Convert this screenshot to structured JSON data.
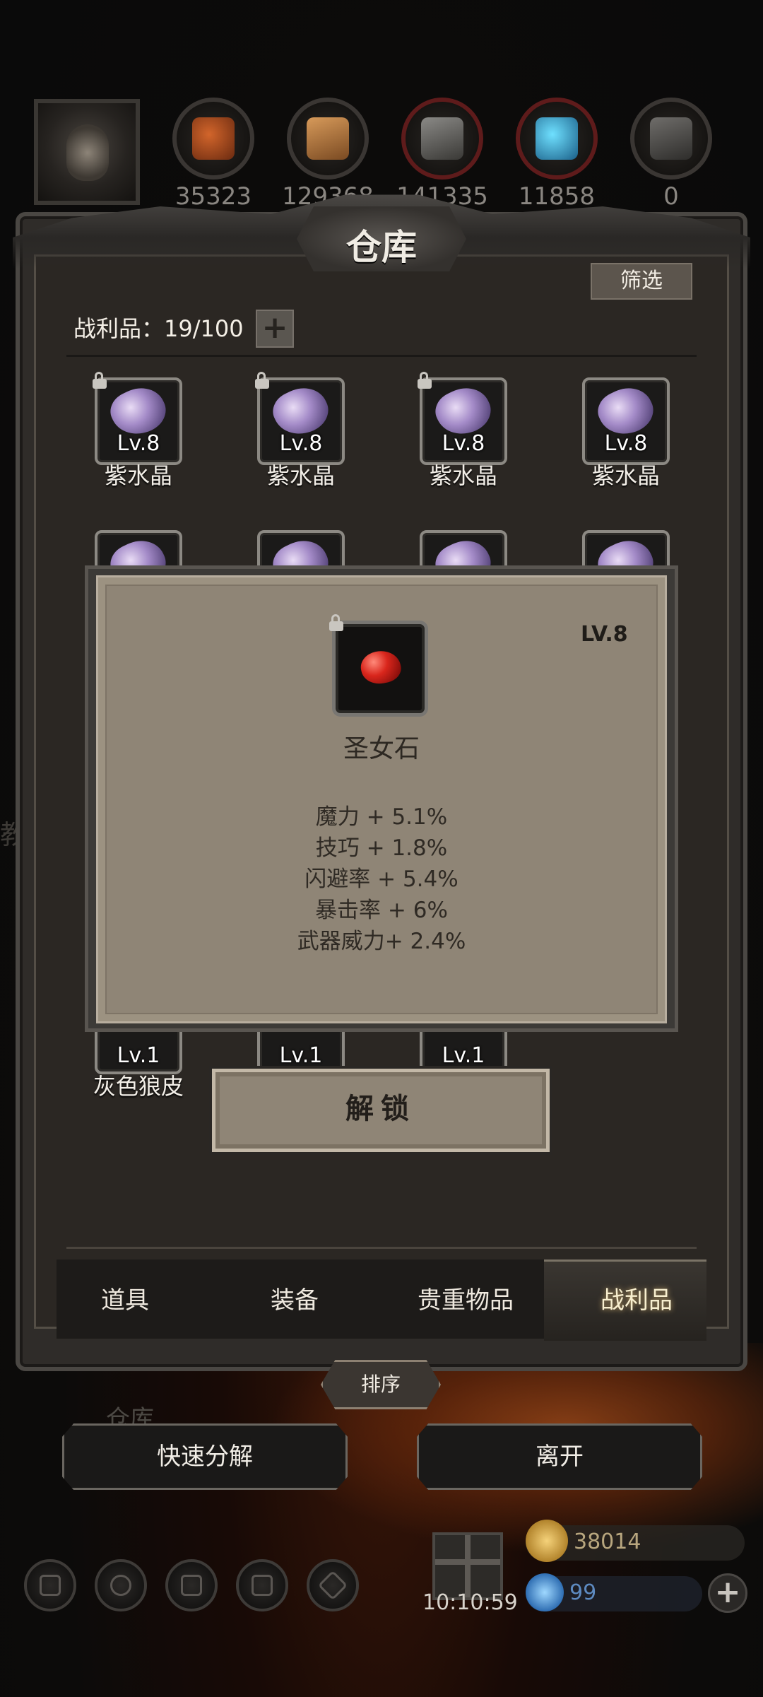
{
  "top_bar": {
    "resources": [
      {
        "name": "meat",
        "icon": "meat-icon",
        "value": "35323"
      },
      {
        "name": "wood",
        "icon": "wood-icon",
        "value": "129368"
      },
      {
        "name": "stone",
        "icon": "stone-icon",
        "value": "141335"
      },
      {
        "name": "crystal",
        "icon": "crystal-icon",
        "value": "11858"
      },
      {
        "name": "iron",
        "icon": "iron-icon",
        "value": "0"
      }
    ]
  },
  "panel": {
    "title": "仓库",
    "filter_label": "筛选",
    "loot_count": "战利品：19/100",
    "items_row1": [
      {
        "level": "Lv.8",
        "name": "紫水晶"
      },
      {
        "level": "Lv.8",
        "name": "紫水晶"
      },
      {
        "level": "Lv.8",
        "name": "紫水晶"
      },
      {
        "level": "Lv.8",
        "name": "紫水晶"
      }
    ],
    "items_row_last": [
      {
        "level": "Lv.1",
        "name": "灰色狼皮"
      },
      {
        "level": "Lv.1",
        "name": ""
      },
      {
        "level": "Lv.1",
        "name": ""
      }
    ],
    "tabs": [
      {
        "label": "道具",
        "active": false
      },
      {
        "label": "装备",
        "active": false
      },
      {
        "label": "贵重物品",
        "active": false
      },
      {
        "label": "战利品",
        "active": true
      }
    ],
    "sort_label": "排序"
  },
  "popup": {
    "level": "LV.8",
    "item_name": "圣女石",
    "stats": [
      "魔力 + 5.1%",
      "技巧 + 1.8%",
      "闪避率 + 5.4%",
      "暴击率 + 6%",
      "武器威力+ 2.4%"
    ],
    "unlock_label": "解锁"
  },
  "actions": {
    "quick_decompose": "快速分解",
    "leave": "离开"
  },
  "background": {
    "side_text": "教",
    "scene_label": "仓库"
  },
  "hud": {
    "timer": "10:10:59",
    "coins": "38014",
    "gems": "99",
    "plus": "+"
  },
  "colors": {
    "panel_bg": "#2b2723",
    "popup_bg": "#8f8576",
    "accent_gold": "#c9a86a"
  }
}
